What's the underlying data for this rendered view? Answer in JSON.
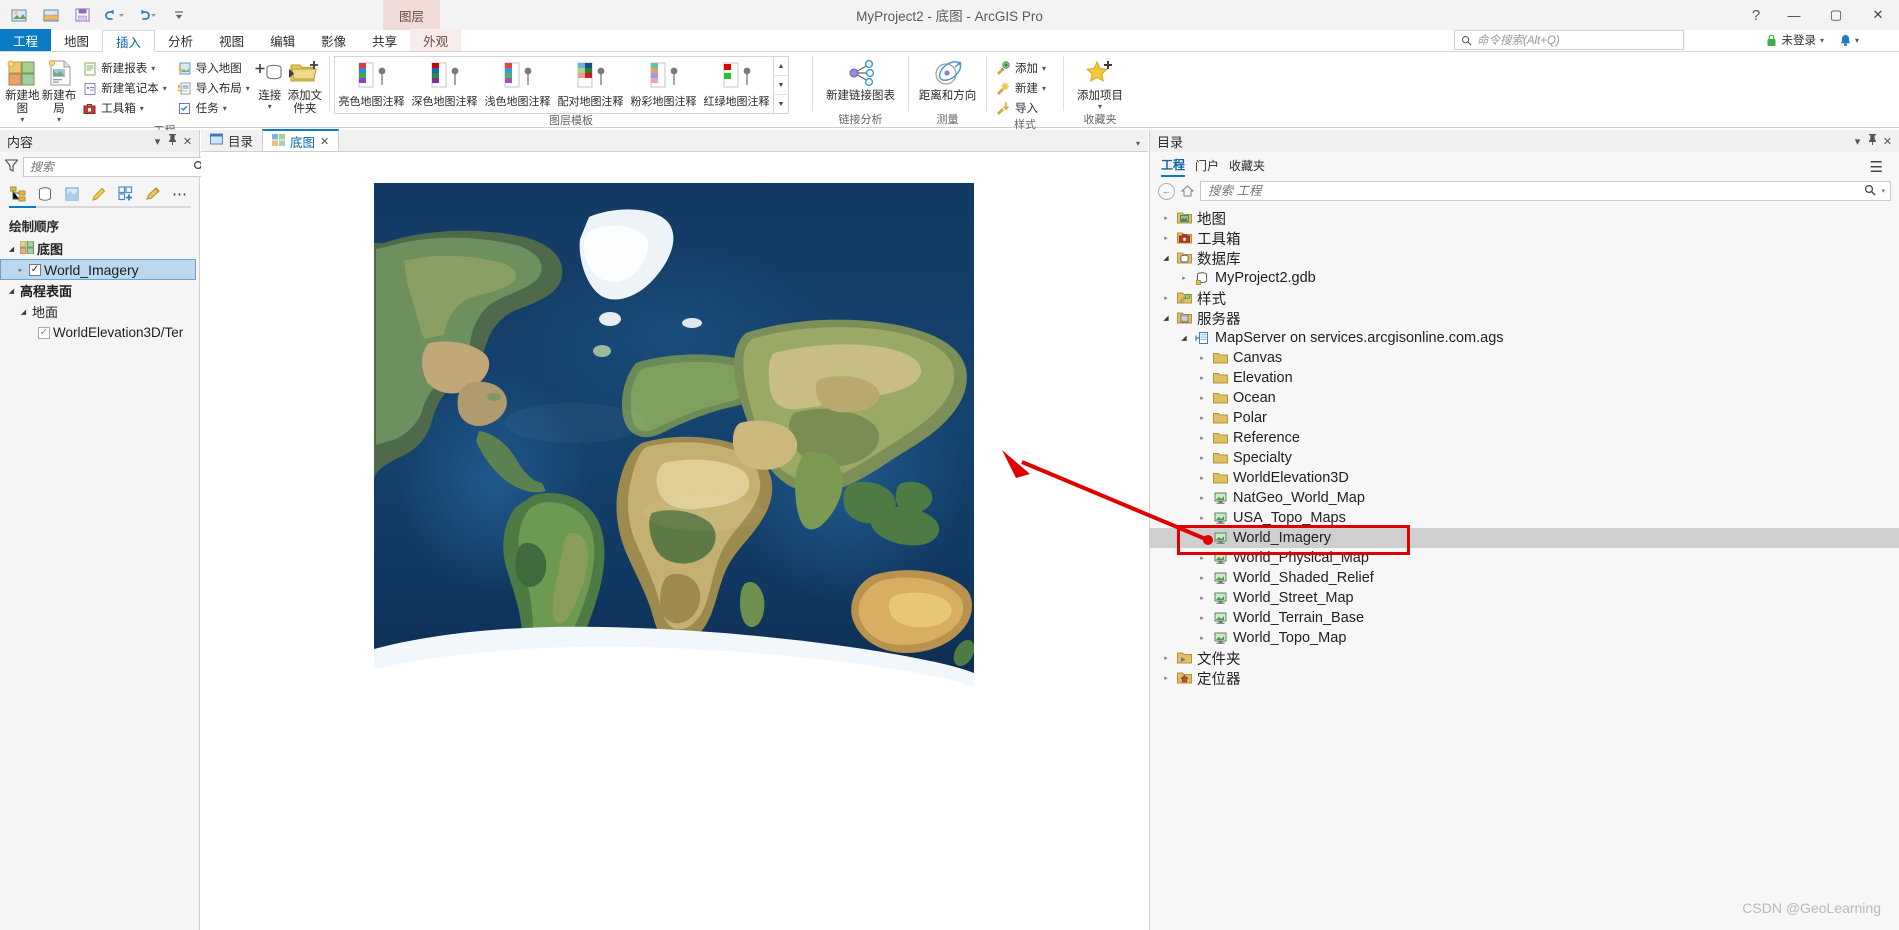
{
  "titlebar": {
    "title": "MyProject2 - 底图 - ArcGIS Pro",
    "quick_access": [
      "new-project-icon",
      "open-project-icon",
      "save-project-icon",
      "undo-icon",
      "redo-icon",
      "customize-qat-icon"
    ],
    "help_label": "?",
    "minimize_label": "—",
    "maximize_label": "▢",
    "close_label": "✕",
    "contextual_group_label": "图层"
  },
  "tabs": [
    {
      "label": "工程",
      "state": "project"
    },
    {
      "label": "地图",
      "state": "normal"
    },
    {
      "label": "插入",
      "state": "active"
    },
    {
      "label": "分析",
      "state": "normal"
    },
    {
      "label": "视图",
      "state": "normal"
    },
    {
      "label": "编辑",
      "state": "normal"
    },
    {
      "label": "影像",
      "state": "normal"
    },
    {
      "label": "共享",
      "state": "normal"
    },
    {
      "label": "外观",
      "state": "contextual"
    }
  ],
  "command_search": {
    "placeholder": "命令搜索(Alt+Q)",
    "icon": "search-icon"
  },
  "account": {
    "label": "未登录",
    "lock_icon": "lock-icon",
    "notification_icon": "bell-icon"
  },
  "ribbon": {
    "groups": [
      {
        "label": "工程",
        "big_buttons": [
          {
            "label": "新建地图",
            "icon": "new-map-icon",
            "has_caret": true
          },
          {
            "label": "新建布局",
            "icon": "new-layout-icon",
            "has_caret": true
          }
        ],
        "small_buttons_col1": [
          {
            "label": "新建报表",
            "icon": "new-report-icon",
            "has_caret": true
          },
          {
            "label": "新建笔记本",
            "icon": "new-notebook-icon",
            "has_caret": true
          },
          {
            "label": "工具箱",
            "icon": "toolbox-icon",
            "has_caret": true
          }
        ],
        "small_buttons_col2": [
          {
            "label": "导入地图",
            "icon": "import-map-icon",
            "has_caret": false
          },
          {
            "label": "导入布局",
            "icon": "import-layout-icon",
            "has_caret": true
          },
          {
            "label": "任务",
            "icon": "task-icon",
            "has_caret": true
          }
        ],
        "big_buttons_2": [
          {
            "label": "连接",
            "icon": "connection-icon",
            "has_caret": true
          },
          {
            "label": "添加文件夹",
            "icon": "add-folder-icon",
            "has_caret": false
          }
        ]
      },
      {
        "label": "图层模板",
        "gallery_items": [
          {
            "label": "亮色地图注释",
            "icon": "bright-map-notes-icon"
          },
          {
            "label": "深色地图注释",
            "icon": "dark-map-notes-icon"
          },
          {
            "label": "浅色地图注释",
            "icon": "light-map-notes-icon"
          },
          {
            "label": "配对地图注释",
            "icon": "paired-map-notes-icon"
          },
          {
            "label": "粉彩地图注释",
            "icon": "pastel-map-notes-icon"
          },
          {
            "label": "红绿地图注释",
            "icon": "redgreen-map-notes-icon"
          }
        ],
        "scroll_up": "▲",
        "scroll_down": "▼",
        "scroll_more": "▼"
      },
      {
        "label": "链接分析",
        "big_buttons": [
          {
            "label": "新建链接图表",
            "icon": "link-chart-icon",
            "has_caret": false
          }
        ]
      },
      {
        "label": "测量",
        "big_buttons": [
          {
            "label": "距离和方向",
            "icon": "distance-direction-icon",
            "has_caret": false
          }
        ]
      },
      {
        "label": "样式",
        "small_buttons": [
          {
            "label": "添加",
            "icon": "add-style-icon",
            "has_caret": true
          },
          {
            "label": "新建",
            "icon": "new-style-icon",
            "has_caret": true
          },
          {
            "label": "导入",
            "icon": "import-style-icon",
            "has_caret": false
          }
        ]
      },
      {
        "label": "收藏夹",
        "big_buttons": [
          {
            "label": "添加项目",
            "icon": "add-favorite-star-icon",
            "has_caret": true
          }
        ]
      }
    ]
  },
  "contents_pane": {
    "title": "内容",
    "header_buttons": [
      "dropdown-icon",
      "pin-icon",
      "close-icon"
    ],
    "search": {
      "placeholder": "搜索",
      "filter_icon": "filter-icon",
      "search_icon": "search-icon",
      "caret": "▾"
    },
    "toolbar_icons": [
      "list-by-drawing-order-icon",
      "list-by-data-source-icon",
      "list-by-selection-icon",
      "list-by-editing-icon",
      "list-by-snapping-icon",
      "list-by-labeling-icon",
      "more-icon"
    ],
    "section_label": "绘制顺序",
    "tree": [
      {
        "label": "底图",
        "level": 0,
        "arrow": "open",
        "icon": "basemap-icon",
        "bold": true,
        "checkbox": false,
        "selected": false
      },
      {
        "label": "World_Imagery",
        "level": 1,
        "arrow": "closed",
        "icon": "",
        "bold": false,
        "checkbox": true,
        "checked": true,
        "selected": true
      },
      {
        "label": "高程表面",
        "level": 0,
        "arrow": "open",
        "icon": "",
        "bold": true,
        "checkbox": false,
        "selected": false
      },
      {
        "label": "地面",
        "level": 1,
        "arrow": "open",
        "icon": "",
        "bold": false,
        "checkbox": false,
        "selected": false
      },
      {
        "label": "WorldElevation3D/Ter",
        "level": 2,
        "arrow": "none",
        "icon": "",
        "bold": false,
        "checkbox": true,
        "checked": true,
        "selected": false
      }
    ]
  },
  "view_tabs": [
    {
      "label": "目录",
      "icon": "catalog-view-icon",
      "active": false,
      "closeable": false
    },
    {
      "label": "底图",
      "icon": "map-view-icon",
      "active": true,
      "closeable": true,
      "close_label": "✕"
    }
  ],
  "catalog_pane": {
    "title": "目录",
    "header_buttons": [
      "dropdown-icon",
      "pin-icon",
      "close-icon"
    ],
    "tabs": [
      {
        "label": "工程",
        "active": true
      },
      {
        "label": "门户",
        "active": false
      },
      {
        "label": "收藏夹",
        "active": false
      }
    ],
    "menu_icon": "hamburger-icon",
    "search": {
      "placeholder": "搜索 工程",
      "back_icon": "back-icon",
      "home_icon": "home-icon",
      "search_icon": "search-icon",
      "caret": "▾"
    },
    "tree": [
      {
        "label": "地图",
        "level": 0,
        "arrow": "closed",
        "icon": "maps-folder-icon",
        "selected": false
      },
      {
        "label": "工具箱",
        "level": 0,
        "arrow": "closed",
        "icon": "toolboxes-folder-icon",
        "selected": false
      },
      {
        "label": "数据库",
        "level": 0,
        "arrow": "open",
        "icon": "databases-folder-icon",
        "selected": false
      },
      {
        "label": "MyProject2.gdb",
        "level": 1,
        "arrow": "closed",
        "icon": "gdb-icon",
        "selected": false
      },
      {
        "label": "样式",
        "level": 0,
        "arrow": "closed",
        "icon": "styles-folder-icon",
        "selected": false
      },
      {
        "label": "服务器",
        "level": 0,
        "arrow": "open",
        "icon": "servers-folder-icon",
        "selected": false
      },
      {
        "label": "MapServer on services.arcgisonline.com.ags",
        "level": 1,
        "arrow": "open",
        "icon": "server-connection-icon",
        "selected": false
      },
      {
        "label": "Canvas",
        "level": 2,
        "arrow": "closed",
        "icon": "folder-icon",
        "selected": false
      },
      {
        "label": "Elevation",
        "level": 2,
        "arrow": "closed",
        "icon": "folder-icon",
        "selected": false
      },
      {
        "label": "Ocean",
        "level": 2,
        "arrow": "closed",
        "icon": "folder-icon",
        "selected": false
      },
      {
        "label": "Polar",
        "level": 2,
        "arrow": "closed",
        "icon": "folder-icon",
        "selected": false
      },
      {
        "label": "Reference",
        "level": 2,
        "arrow": "closed",
        "icon": "folder-icon",
        "selected": false
      },
      {
        "label": "Specialty",
        "level": 2,
        "arrow": "closed",
        "icon": "folder-icon",
        "selected": false
      },
      {
        "label": "WorldElevation3D",
        "level": 2,
        "arrow": "closed",
        "icon": "folder-icon",
        "selected": false
      },
      {
        "label": "NatGeo_World_Map",
        "level": 2,
        "arrow": "closed",
        "icon": "map-service-icon",
        "selected": false
      },
      {
        "label": "USA_Topo_Maps",
        "level": 2,
        "arrow": "closed",
        "icon": "map-service-icon",
        "selected": false
      },
      {
        "label": "World_Imagery",
        "level": 2,
        "arrow": "closed",
        "icon": "map-service-icon",
        "selected": true
      },
      {
        "label": "World_Physical_Map",
        "level": 2,
        "arrow": "closed",
        "icon": "map-service-icon",
        "selected": false
      },
      {
        "label": "World_Shaded_Relief",
        "level": 2,
        "arrow": "closed",
        "icon": "map-service-icon",
        "selected": false
      },
      {
        "label": "World_Street_Map",
        "level": 2,
        "arrow": "closed",
        "icon": "map-service-icon",
        "selected": false
      },
      {
        "label": "World_Terrain_Base",
        "level": 2,
        "arrow": "closed",
        "icon": "map-service-icon",
        "selected": false
      },
      {
        "label": "World_Topo_Map",
        "level": 2,
        "arrow": "closed",
        "icon": "map-service-icon",
        "selected": false
      },
      {
        "label": "文件夹",
        "level": 0,
        "arrow": "closed",
        "icon": "folders-icon",
        "selected": false
      },
      {
        "label": "定位器",
        "level": 0,
        "arrow": "closed",
        "icon": "locators-icon",
        "selected": false
      }
    ]
  },
  "annotation": {
    "highlight_color": "#e00000",
    "target_label": "World_Imagery"
  },
  "watermark": "CSDN @GeoLearning",
  "colors": {
    "accent": "#0a7bc4",
    "contextual": "#f0dcd8",
    "selection": "#bcd8ee",
    "catalog_selection": "#cfcfcf"
  }
}
